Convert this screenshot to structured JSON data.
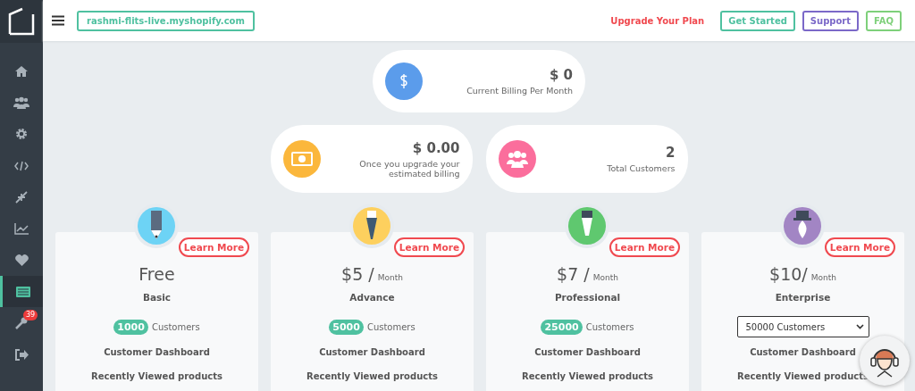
{
  "sidebar": {
    "items": [
      {
        "selected": false
      },
      {
        "selected": false
      },
      {
        "selected": false
      },
      {
        "selected": false
      },
      {
        "selected": false
      },
      {
        "selected": false
      },
      {
        "selected": false
      },
      {
        "selected": true
      },
      {
        "selected": false,
        "badge": "39"
      },
      {
        "selected": false
      }
    ]
  },
  "topbar": {
    "store": "rashmi-flits-live.myshopify.com",
    "upgrade": "Upgrade Your Plan",
    "buttons": [
      {
        "label": "Get Started",
        "color": "#4fc1a0"
      },
      {
        "label": "Support",
        "color": "#7b68c8"
      },
      {
        "label": "FAQ",
        "color": "#7ed07a"
      }
    ]
  },
  "stats": [
    {
      "color": "#5b9ceb",
      "value": "$ 0",
      "label": "Current Billing Per Month"
    },
    {
      "color": "#fbb73c",
      "value": "$ 0.00",
      "label": "Once you upgrade your estimated billing"
    },
    {
      "color": "#fb6e9c",
      "value": "2",
      "label": "Total Customers"
    }
  ],
  "plans": [
    {
      "color": "#6dd3f5",
      "learn": "Learn More",
      "price": "Free",
      "name": "Basic",
      "kind": "badge",
      "count": "1000",
      "count_label": "Customers",
      "features": [
        "Customer Dashboard",
        "Recently Viewed products"
      ]
    },
    {
      "color": "#fdd05e",
      "learn": "Learn More",
      "price": "$5 /",
      "per": "Month",
      "name": "Advance",
      "kind": "badge",
      "count": "5000",
      "count_label": "Customers",
      "features": [
        "Customer Dashboard",
        "Recently Viewed products"
      ]
    },
    {
      "color": "#5fc86f",
      "learn": "Learn More",
      "price": "$7 /",
      "per": "Month",
      "name": "Professional",
      "kind": "badge",
      "count": "25000",
      "count_label": "Customers",
      "features": [
        "Customer Dashboard",
        "Recently Viewed products"
      ]
    },
    {
      "color": "#a285c4",
      "learn": "Learn More",
      "price": "$10/",
      "per": "Month",
      "name": "Enterprise",
      "kind": "select",
      "select_value": "50000 Customers",
      "features": [
        "Customer Dashboard",
        "Recently Viewed products"
      ]
    }
  ]
}
